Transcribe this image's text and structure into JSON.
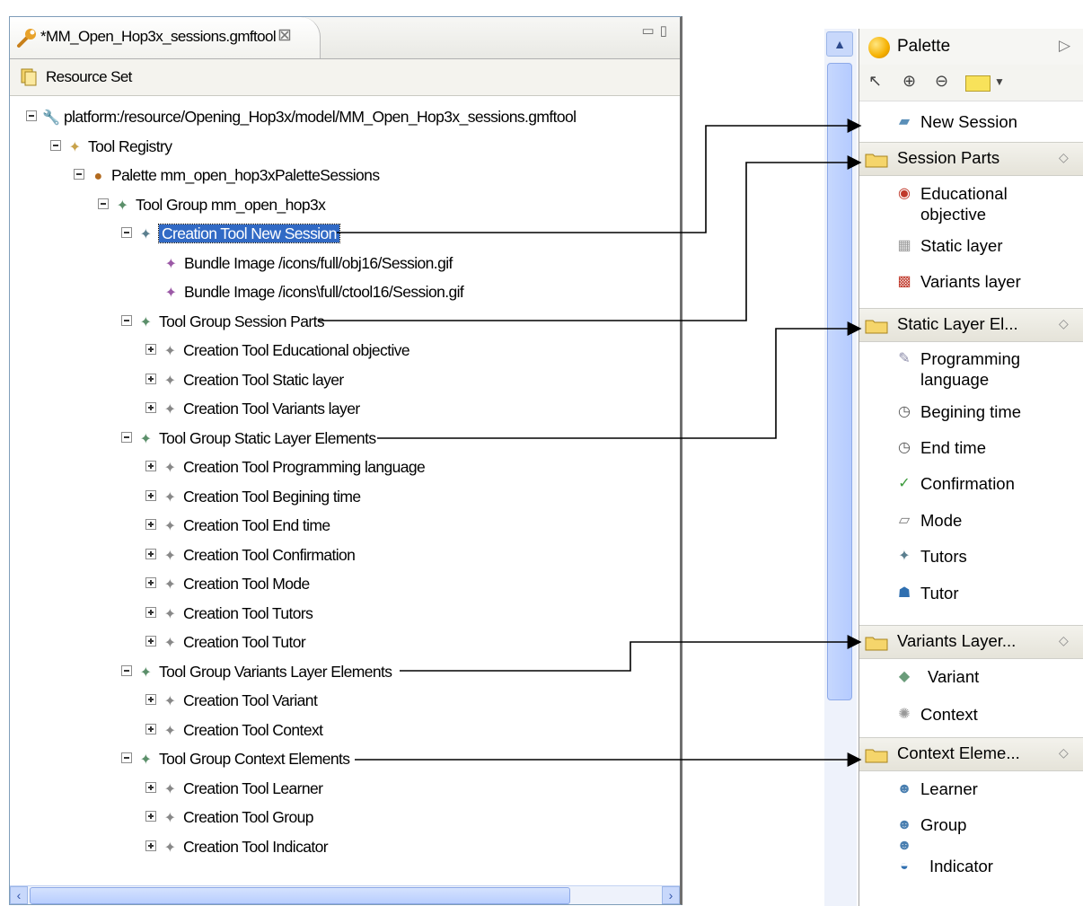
{
  "editor": {
    "tab_title": "*MM_Open_Hop3x_sessions.gmftool",
    "tab_close": "⊠",
    "resource_set": "Resource Set",
    "tree": [
      {
        "text": "platform:/resource/Opening_Hop3x/model/MM_Open_Hop3x_sessions.gmftool"
      },
      {
        "text": "Tool Registry"
      },
      {
        "text": "Palette mm_open_hop3xPaletteSessions"
      },
      {
        "text": "Tool Group mm_open_hop3x"
      },
      {
        "text": "Creation Tool New Session"
      },
      {
        "text": "Bundle Image /icons/full/obj16/Session.gif"
      },
      {
        "text": "Bundle Image /icons\\full/ctool16/Session.gif"
      },
      {
        "text": "Tool Group Session Parts"
      },
      {
        "text": "Creation Tool Educational objective"
      },
      {
        "text": "Creation Tool Static layer"
      },
      {
        "text": "Creation Tool Variants layer"
      },
      {
        "text": "Tool Group Static Layer Elements"
      },
      {
        "text": "Creation Tool Programming language"
      },
      {
        "text": "Creation Tool Begining time"
      },
      {
        "text": "Creation Tool End time"
      },
      {
        "text": "Creation Tool Confirmation"
      },
      {
        "text": "Creation Tool Mode"
      },
      {
        "text": "Creation Tool Tutors"
      },
      {
        "text": "Creation Tool Tutor"
      },
      {
        "text": "Tool Group Variants Layer Elements"
      },
      {
        "text": "Creation Tool Variant"
      },
      {
        "text": "Creation Tool Context"
      },
      {
        "text": "Tool Group Context Elements"
      },
      {
        "text": "Creation Tool Learner"
      },
      {
        "text": "Creation Tool Group"
      },
      {
        "text": "Creation Tool Indicator"
      }
    ]
  },
  "palette": {
    "title": "Palette",
    "new_session": "New Session",
    "drawers": [
      {
        "label": "Session Parts",
        "items": [
          "Educational\nobjective",
          "Static layer",
          "Variants layer"
        ]
      },
      {
        "label": "Static Layer El...",
        "items": [
          "Programming\nlanguage",
          "Begining time",
          "End time",
          "Confirmation",
          "Mode",
          "Tutors",
          "Tutor"
        ]
      },
      {
        "label": "Variants Layer...",
        "items": [
          "Variant",
          "Context"
        ]
      },
      {
        "label": "Context Eleme...",
        "items": [
          "Learner",
          "Group",
          "Indicator"
        ]
      }
    ]
  },
  "colors": {
    "selection": "#316ac5",
    "scrollbar": "#c8d8fb",
    "drawer": "#ece9d8"
  }
}
